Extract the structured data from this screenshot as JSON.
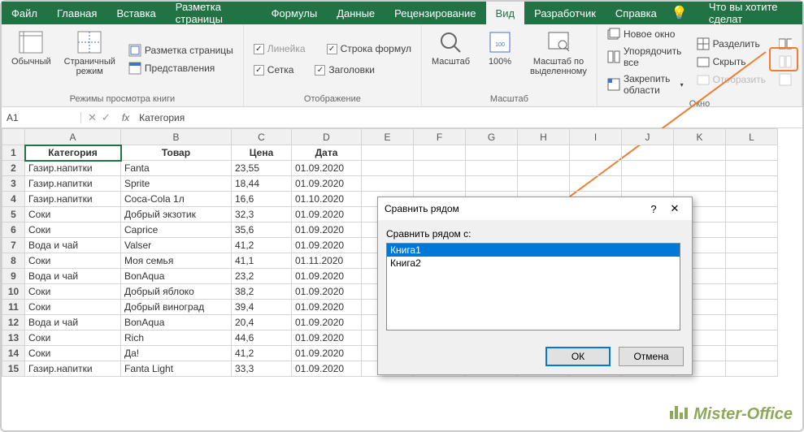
{
  "tabs": {
    "file": "Файл",
    "home": "Главная",
    "insert": "Вставка",
    "layout": "Разметка страницы",
    "formulas": "Формулы",
    "data": "Данные",
    "review": "Рецензирование",
    "view": "Вид",
    "developer": "Разработчик",
    "help": "Справка",
    "tell": "Что вы хотите сделат"
  },
  "ribbon": {
    "views": {
      "normal": "Обычный",
      "pagebreak": "Страничный\nрежим",
      "pagelayout": "Разметка страницы",
      "customviews": "Представления",
      "group": "Режимы просмотра книги"
    },
    "show": {
      "ruler": "Линейка",
      "formulabar": "Строка формул",
      "gridlines": "Сетка",
      "headings": "Заголовки",
      "group": "Отображение"
    },
    "zoom": {
      "zoom": "Масштаб",
      "hundred": "100%",
      "selection": "Масштаб по\nвыделенному",
      "group": "Масштаб"
    },
    "window": {
      "new": "Новое окно",
      "arrange": "Упорядочить все",
      "freeze": "Закрепить области",
      "split": "Разделить",
      "hide": "Скрыть",
      "unhide": "Отобразить",
      "group": "Окно"
    }
  },
  "formula": {
    "cellref": "A1",
    "value": "Категория"
  },
  "columns": [
    "A",
    "B",
    "C",
    "D",
    "E",
    "F",
    "G",
    "H",
    "I",
    "J",
    "K",
    "L"
  ],
  "headers": {
    "cat": "Категория",
    "prod": "Товар",
    "price": "Цена",
    "date": "Дата"
  },
  "rows": [
    {
      "cat": "Газир.напитки",
      "prod": "Fanta",
      "price": "23,55",
      "date": "01.09.2020"
    },
    {
      "cat": "Газир.напитки",
      "prod": "Sprite",
      "price": "18,44",
      "date": "01.09.2020"
    },
    {
      "cat": "Газир.напитки",
      "prod": "Coca-Cola 1л",
      "price": "16,6",
      "date": "01.10.2020"
    },
    {
      "cat": "Соки",
      "prod": "Добрый экзотик",
      "price": "32,3",
      "date": "01.09.2020"
    },
    {
      "cat": "Соки",
      "prod": "Caprice",
      "price": "35,6",
      "date": "01.09.2020"
    },
    {
      "cat": "Вода и чай",
      "prod": "Valser",
      "price": "41,2",
      "date": "01.09.2020"
    },
    {
      "cat": "Соки",
      "prod": "Моя семья",
      "price": "41,1",
      "date": "01.11.2020"
    },
    {
      "cat": "Вода и чай",
      "prod": "BonAqua",
      "price": "23,2",
      "date": "01.09.2020"
    },
    {
      "cat": "Соки",
      "prod": "Добрый яблоко",
      "price": "38,2",
      "date": "01.09.2020"
    },
    {
      "cat": "Соки",
      "prod": "Добрый виноград",
      "price": "39,4",
      "date": "01.09.2020"
    },
    {
      "cat": "Вода и чай",
      "prod": "BonAqua",
      "price": "20,4",
      "date": "01.09.2020"
    },
    {
      "cat": "Соки",
      "prod": "Rich",
      "price": "44,6",
      "date": "01.09.2020"
    },
    {
      "cat": "Соки",
      "prod": "Да!",
      "price": "41,2",
      "date": "01.09.2020"
    },
    {
      "cat": "Газир.напитки",
      "prod": "Fanta Light",
      "price": "33,3",
      "date": "01.09.2020"
    }
  ],
  "dialog": {
    "title": "Сравнить рядом",
    "label": "Сравнить рядом с:",
    "items": [
      "Книга1",
      "Книга2"
    ],
    "ok": "ОК",
    "cancel": "Отмена"
  },
  "watermark": "Mister-Office"
}
